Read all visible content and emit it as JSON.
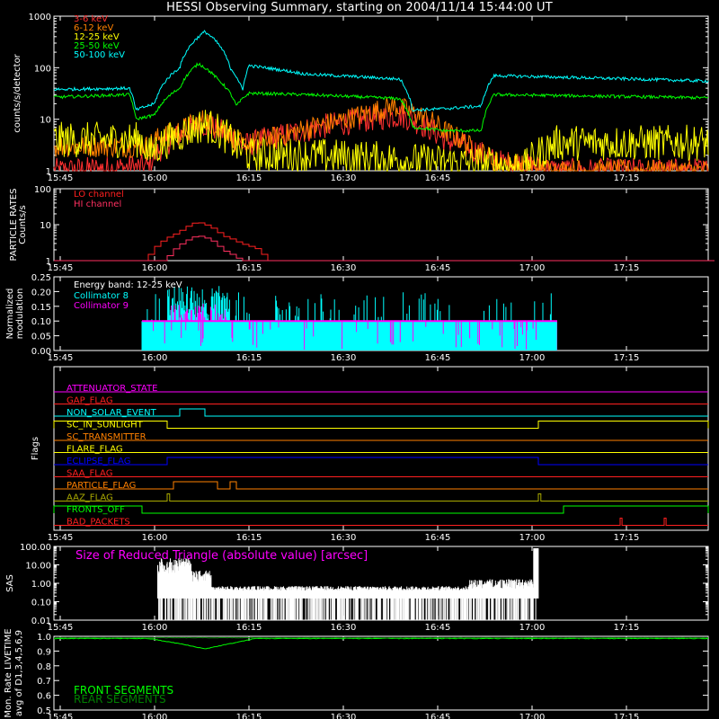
{
  "title": "HESSI Observing Summary, starting on 2004/11/14 15:44:00 UT",
  "x_ticks": [
    "15:45",
    "16:00",
    "16:15",
    "16:30",
    "16:45",
    "17:00",
    "17:15"
  ],
  "x_tick_minutes": [
    1,
    16,
    31,
    46,
    61,
    76,
    91
  ],
  "x_range_minutes": [
    0,
    104
  ],
  "colors": {
    "3-6": "#ff3030",
    "6-12": "#ff8000",
    "12-25": "#ffff00",
    "25-50": "#00ff00",
    "50-100": "#00ffff",
    "white": "#ffffff",
    "magenta": "#ff00ff",
    "red": "#ff2020",
    "hi": "#ff3060",
    "flag_blue": "#0000ff",
    "flag_darkyellow": "#aaaa00",
    "flag_green": "#00ff00",
    "frame": "#ffffff"
  },
  "chart_data": [
    {
      "id": "counts",
      "type": "line",
      "ylabel": "counts/s/detector",
      "yscale": "log",
      "ylim": [
        1,
        1000
      ],
      "y_ticks": [
        "1",
        "10",
        "100",
        "1000"
      ],
      "y_tick_values": [
        1,
        10,
        100,
        1000
      ],
      "legend_position": "top-left",
      "series": [
        {
          "name": "3-6 keV",
          "color": "#ff3030",
          "x": [
            1,
            15,
            20,
            24,
            30,
            37,
            45,
            55,
            62,
            70,
            80,
            95,
            104
          ],
          "y": [
            1,
            1.2,
            5,
            8,
            3,
            5,
            8,
            12,
            4,
            1.5,
            1,
            1,
            1
          ]
        },
        {
          "name": "6-12 keV",
          "color": "#ff8000",
          "x": [
            1,
            15,
            16,
            20,
            24,
            28,
            30,
            37,
            45,
            50,
            54,
            58,
            62,
            66,
            70,
            80,
            104
          ],
          "y": [
            3,
            3,
            4,
            6,
            10,
            5,
            3,
            5,
            9,
            13,
            18,
            12,
            6,
            3,
            1.5,
            1,
            1
          ]
        },
        {
          "name": "12-25 keV",
          "color": "#ffff00",
          "x": [
            1,
            14,
            15,
            20,
            24,
            29,
            31,
            40,
            60,
            75,
            80,
            104
          ],
          "y": [
            4,
            4,
            2,
            5,
            8,
            3,
            2,
            2,
            1.5,
            1.2,
            3.5,
            3.5
          ]
        },
        {
          "name": "25-50 keV",
          "color": "#00ff00",
          "x": [
            1,
            12,
            13,
            16,
            20,
            23,
            26,
            29,
            31,
            40,
            55,
            57,
            62,
            68,
            70,
            104
          ],
          "y": [
            27,
            30,
            10,
            12,
            40,
            120,
            60,
            18,
            32,
            30,
            25,
            7,
            6,
            6,
            30,
            26
          ]
        },
        {
          "name": "50-100 keV",
          "color": "#00ffff",
          "x": [
            1,
            12,
            13,
            16,
            20,
            24,
            28,
            30,
            31,
            40,
            55,
            57,
            62,
            68,
            70,
            104
          ],
          "y": [
            38,
            40,
            15,
            20,
            100,
            500,
            100,
            35,
            110,
            75,
            60,
            15,
            16,
            18,
            70,
            55
          ]
        }
      ]
    },
    {
      "id": "particle",
      "type": "line",
      "ylabel": "PARTICLE RATES",
      "ylabel2": "Counts/s",
      "yscale": "log",
      "ylim": [
        1,
        100
      ],
      "y_ticks": [
        "1",
        "10",
        "100"
      ],
      "y_tick_values": [
        1,
        10,
        100
      ],
      "series": [
        {
          "name": "LO channel",
          "color": "#ff2020",
          "x": [
            1,
            15,
            17,
            20,
            23,
            25,
            27,
            30,
            33,
            34,
            35,
            104
          ],
          "y": [
            1,
            1,
            3,
            6,
            12,
            9,
            5,
            3,
            2,
            1,
            1,
            1
          ]
        },
        {
          "name": "HI channel",
          "color": "#ff3060",
          "x": [
            1,
            18,
            20,
            23,
            25,
            27,
            30,
            104
          ],
          "y": [
            1,
            1,
            2.5,
            5,
            4,
            2,
            1,
            1
          ]
        }
      ]
    },
    {
      "id": "modulation",
      "type": "bar",
      "ylabel": "Normalized",
      "ylabel2": "modulation",
      "ylim": [
        0,
        0.25
      ],
      "y_ticks": [
        "0.00",
        "0.05",
        "0.10",
        "0.15",
        "0.20",
        "0.25"
      ],
      "y_tick_values": [
        0,
        0.05,
        0.1,
        0.15,
        0.2,
        0.25
      ],
      "annotation": "Energy band: 12-25 keV",
      "x_range": [
        14,
        80
      ],
      "base_level": 0.1,
      "series": [
        {
          "name": "Collimator 8",
          "color": "#00ffff"
        },
        {
          "name": "Collimator 9",
          "color": "#ff00ff"
        }
      ]
    },
    {
      "id": "flags",
      "type": "line",
      "ylabel": "Flags",
      "rows": [
        {
          "name": "ATTENUATOR_STATE",
          "color": "#ff00ff",
          "segments": []
        },
        {
          "name": "GAP_FLAG",
          "color": "#ff2020",
          "segments": []
        },
        {
          "name": "NON_SOLAR_EVENT",
          "color": "#00ffff",
          "segments": [
            [
              20,
              24
            ]
          ]
        },
        {
          "name": "SC_IN_SUNLIGHT",
          "color": "#ffff00",
          "segments": [
            [
              -10,
              18
            ],
            [
              77,
              120
            ]
          ]
        },
        {
          "name": "SC_TRANSMITTER",
          "color": "#ff8000",
          "segments": []
        },
        {
          "name": "FLARE_FLAG",
          "color": "#ffff00",
          "segments": []
        },
        {
          "name": "ECLIPSE_FLAG",
          "color": "#0000ff",
          "segments": [
            [
              18,
              77
            ]
          ]
        },
        {
          "name": "SAA_FLAG",
          "color": "#ff2020",
          "segments": []
        },
        {
          "name": "PARTICLE_FLAG",
          "color": "#ff8000",
          "segments": [
            [
              19,
              26
            ],
            [
              28,
              29
            ]
          ]
        },
        {
          "name": "AAZ_FLAG",
          "color": "#aaaa00",
          "segments": [
            [
              18,
              18.4
            ],
            [
              77,
              77.4
            ]
          ]
        },
        {
          "name": "FRONTS_OFF",
          "color": "#00ff00",
          "segments": [
            [
              -10,
              14
            ],
            [
              81,
              120
            ]
          ]
        },
        {
          "name": "BAD_PACKETS",
          "color": "#ff2020",
          "segments": [
            [
              90,
              90.3
            ],
            [
              97,
              97.3
            ]
          ]
        }
      ]
    },
    {
      "id": "sas",
      "type": "bar",
      "ylabel": "SAS",
      "yscale": "log",
      "ylim": [
        0.01,
        100
      ],
      "y_ticks": [
        "0.01",
        "0.10",
        "1.00",
        "10.00",
        "100.00"
      ],
      "y_tick_values": [
        0.01,
        0.1,
        1,
        10,
        100
      ],
      "annotation": "Size of Reduced Triangle (absolute value) [arcsec]",
      "x_range": [
        16.5,
        77
      ],
      "series": [
        {
          "name": "SAS",
          "color": "#ffffff"
        }
      ]
    },
    {
      "id": "livetime",
      "type": "line",
      "ylabel": "Mon. Rate LIVETIME",
      "ylabel2": "avg of D1,3,4,5,6,9",
      "ylim": [
        0.5,
        1.0
      ],
      "y_ticks": [
        "0.5",
        "0.6",
        "0.7",
        "0.8",
        "0.9",
        "1.0"
      ],
      "y_tick_values": [
        0.5,
        0.6,
        0.7,
        0.8,
        0.9,
        1.0
      ],
      "legend_position": "bottom-left",
      "series": [
        {
          "name": "FRONT SEGMENTS",
          "color": "#00ff00",
          "x": [
            1,
            15,
            20,
            24,
            28,
            32,
            104
          ],
          "y": [
            0.985,
            0.985,
            0.95,
            0.915,
            0.95,
            0.985,
            0.985
          ]
        },
        {
          "name": "REAR SEGMENTS",
          "color": "#008000",
          "x": [
            1,
            104
          ],
          "y": [
            0.99,
            0.99
          ]
        }
      ]
    }
  ]
}
